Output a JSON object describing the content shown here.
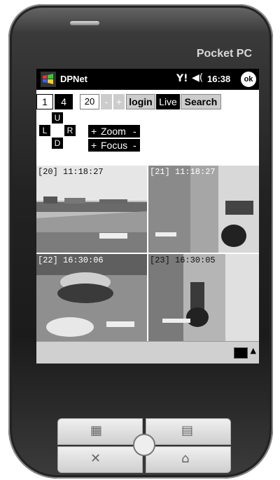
{
  "device": {
    "brand": "Pocket PC"
  },
  "titlebar": {
    "app_title": "DPNet",
    "signal": "Y!",
    "volume": "◀(",
    "time": "16:38",
    "ok_label": "ok"
  },
  "controls": {
    "btn_1": "1",
    "btn_4": "4",
    "count_value": "20",
    "minus": "-",
    "plus": "+",
    "login": "login",
    "live": "Live",
    "search": "Search",
    "dpad": {
      "up": "U",
      "left": "L",
      "right": "R",
      "down": "D"
    },
    "zoom": {
      "plus": "+",
      "label": "Zoom",
      "minus": "-"
    },
    "focus": {
      "plus": "+",
      "label": "Focus",
      "minus": "-"
    }
  },
  "cameras": [
    {
      "label": "[20] 11:18:27"
    },
    {
      "label": "[21] 11:18:27"
    },
    {
      "label": "[22] 16:30:06"
    },
    {
      "label": "[23] 16:30:05"
    }
  ]
}
